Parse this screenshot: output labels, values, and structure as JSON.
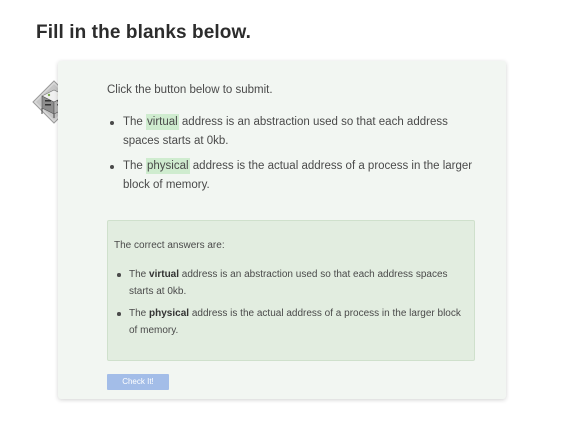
{
  "page": {
    "title": "Fill in the blanks below."
  },
  "card": {
    "prompt": "Click the button below to submit.",
    "avatar_icon": "server-rack-icon",
    "questions": [
      {
        "before": "The ",
        "blank": "virtual",
        "after": " address is an abstraction used so that each address spaces starts at 0kb."
      },
      {
        "before": "The ",
        "blank": "physical",
        "after": " address is the actual address of a process in the larger block of memory."
      }
    ],
    "answers": {
      "heading": "The correct answers are:",
      "items": [
        {
          "before": "The ",
          "answer": "virtual",
          "after": " address is an abstraction used so that each address spaces starts at 0kb."
        },
        {
          "before": "The ",
          "answer": "physical",
          "after": " address is the actual address of a process in the larger block of memory."
        }
      ]
    },
    "check_button_label": "Check It!"
  },
  "colors": {
    "card_bg": "#f2f6f2",
    "blank_highlight": "#cfeccf",
    "answer_box_bg": "#e2ede0",
    "button_bg": "#a3bde8"
  }
}
